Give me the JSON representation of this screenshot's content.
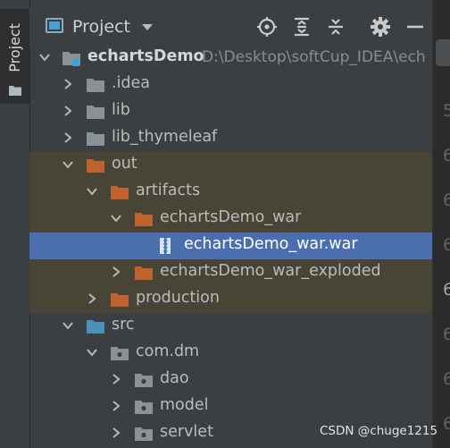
{
  "sidebar": {
    "tab_label": "Project"
  },
  "header": {
    "title": "Project"
  },
  "tree": {
    "root": {
      "label": "echartsDemo",
      "path": "D:\\Desktop\\softCup_IDEA\\ech"
    },
    "items": [
      {
        "label": ".idea"
      },
      {
        "label": "lib"
      },
      {
        "label": "lib_thymeleaf"
      },
      {
        "label": "out"
      },
      {
        "label": "artifacts"
      },
      {
        "label": "echartsDemo_war"
      },
      {
        "label": "echartsDemo_war.war"
      },
      {
        "label": "echartsDemo_war_exploded"
      },
      {
        "label": "production"
      },
      {
        "label": "src"
      },
      {
        "label": "com.dm"
      },
      {
        "label": "dao"
      },
      {
        "label": "model"
      },
      {
        "label": "servlet"
      }
    ]
  },
  "gutter": {
    "lines": [
      "5",
      "6",
      "6",
      "6",
      "6",
      "6",
      "6",
      "6",
      "6",
      "6",
      "6"
    ]
  },
  "watermark": "CSDN @chuge1215",
  "colors": {
    "background": "#3c3f41",
    "selection": "#4b6eaf",
    "modified_row": "#484537",
    "excluded_folder": "#c0622b",
    "source_folder": "#4a90b8",
    "plain_folder": "#8a9299"
  }
}
